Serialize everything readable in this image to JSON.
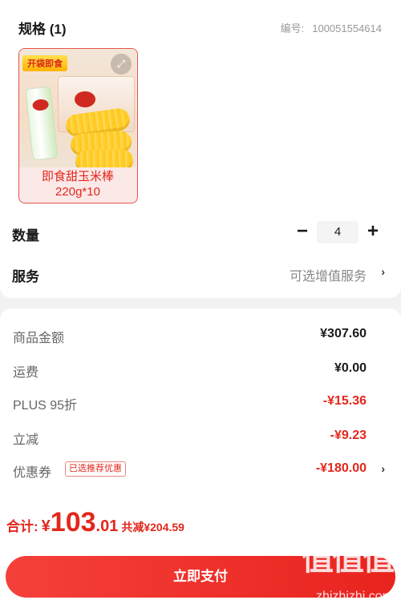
{
  "spec": {
    "title": "规格 (1)",
    "sku_label": "编号:",
    "sku_value": "100051554614"
  },
  "product": {
    "badge": "开袋即食",
    "name_line1": "即食甜玉米棒",
    "name_line2": "220g*10",
    "icon": "zoom-icon"
  },
  "quantity": {
    "label": "数量",
    "minus": "−",
    "value": "4",
    "plus": "+"
  },
  "service": {
    "label": "服务",
    "value": "可选增值服务",
    "chevron": "›"
  },
  "fees": {
    "goods_label": "商品金额",
    "goods_value": "¥307.60",
    "shipping_label": "运费",
    "shipping_value": "¥0.00",
    "plus_label": "PLUS 95折",
    "plus_value": "-¥15.36",
    "instant_label": "立减",
    "instant_value": "-¥9.23",
    "coupon_label": "优惠券",
    "coupon_tag": "已选推荐优惠",
    "coupon_value": "-¥180.00",
    "coupon_chevron": "›"
  },
  "total": {
    "label": "合计:",
    "currency": "¥",
    "integer": "103",
    "decimal": ".01",
    "saving": "共减¥204.59"
  },
  "pay_button": "立即支付",
  "watermark": {
    "chars": "值值值",
    "site": "zhizhizhi.com"
  },
  "colors": {
    "accent": "#e2271c",
    "button": "#f5403a"
  }
}
